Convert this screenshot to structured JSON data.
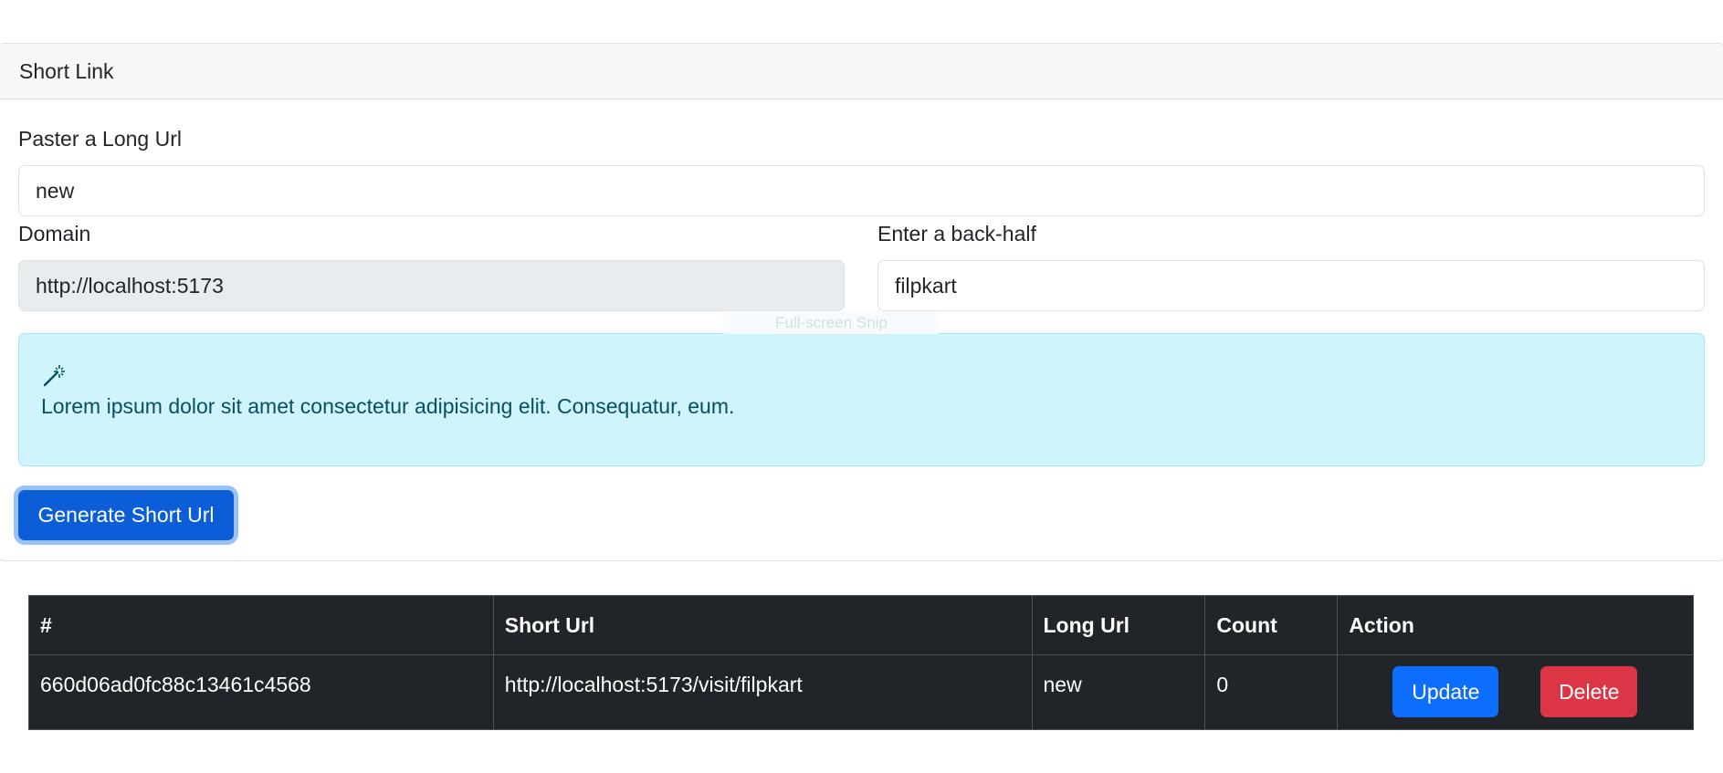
{
  "card": {
    "header_title": "Short Link"
  },
  "form": {
    "long_url_label": "Paster a Long Url",
    "long_url_value": "new",
    "domain_label": "Domain",
    "domain_value": "http://localhost:5173",
    "back_half_label": "Enter a back-half",
    "back_half_value": "filpkart",
    "generate_label": "Generate Short Url"
  },
  "alert": {
    "icon": "magic-wand-icon",
    "text": "Lorem ipsum dolor sit amet consectetur adipisicing elit. Consequatur, eum."
  },
  "overlay": {
    "snip_text": "Full-screen Snip"
  },
  "table": {
    "headers": [
      "#",
      "Short Url",
      "Long Url",
      "Count",
      "Action"
    ],
    "rows": [
      {
        "id": "660d06ad0fc88c13461c4568",
        "short_url": "http://localhost:5173/visit/filpkart",
        "long_url": "new",
        "count": "0",
        "update_label": "Update",
        "delete_label": "Delete"
      }
    ]
  },
  "colors": {
    "primary": "#0d6efd",
    "danger": "#dc3545",
    "info_bg": "#cff4fc",
    "table_dark": "#212529"
  }
}
